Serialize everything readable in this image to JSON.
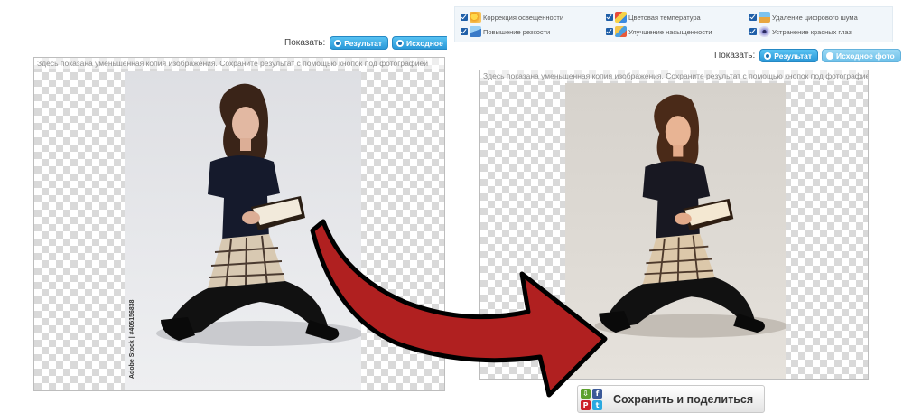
{
  "options": [
    {
      "label": "Коррекция освещенности",
      "icon": "sun-lighting-icon",
      "color": "#f0a020",
      "checked": true
    },
    {
      "label": "Цветовая температура",
      "icon": "color-temperature-icon",
      "color": "#e84a3a",
      "checked": true
    },
    {
      "label": "Удаление цифрового шума",
      "icon": "noise-removal-icon",
      "color": "#4aa0e0",
      "checked": true
    },
    {
      "label": "Повышение резкости",
      "icon": "sharpen-icon",
      "color": "#3a7ac8",
      "checked": true
    },
    {
      "label": "Улучшение насыщенности",
      "icon": "saturation-icon",
      "color": "#e8b040",
      "checked": true
    },
    {
      "label": "Устранение красных глаз",
      "icon": "red-eye-icon",
      "color": "#6a6ab0",
      "checked": true
    }
  ],
  "left_panel": {
    "show_label": "Показать:",
    "result_label": "Результат",
    "original_label": "Исходное",
    "note": "Здесь показана уменьшенная копия изображения. Сохраните результат с помощью кнопок под фотографией",
    "watermark": "Adobe Stock | #405156838"
  },
  "right_panel": {
    "show_label": "Показать:",
    "result_label": "Результат",
    "original_label": "Исходное фото",
    "note": "Здесь показана уменьшенная копия изображения. Сохраните результат с помощью кнопок под фотографией"
  },
  "save_button": {
    "label": "Сохранить и поделиться",
    "socials": [
      {
        "icon": "download-icon",
        "glyph": "⇩",
        "color": "#5aa02c"
      },
      {
        "icon": "facebook-icon",
        "glyph": "f",
        "color": "#3b5998"
      },
      {
        "icon": "pinterest-icon",
        "glyph": "P",
        "color": "#cb2027"
      },
      {
        "icon": "twitter-icon",
        "glyph": "t",
        "color": "#2aa9e0"
      }
    ]
  },
  "colors": {
    "arrow_fill": "#b02020",
    "button_blue": "#2a98d8"
  }
}
